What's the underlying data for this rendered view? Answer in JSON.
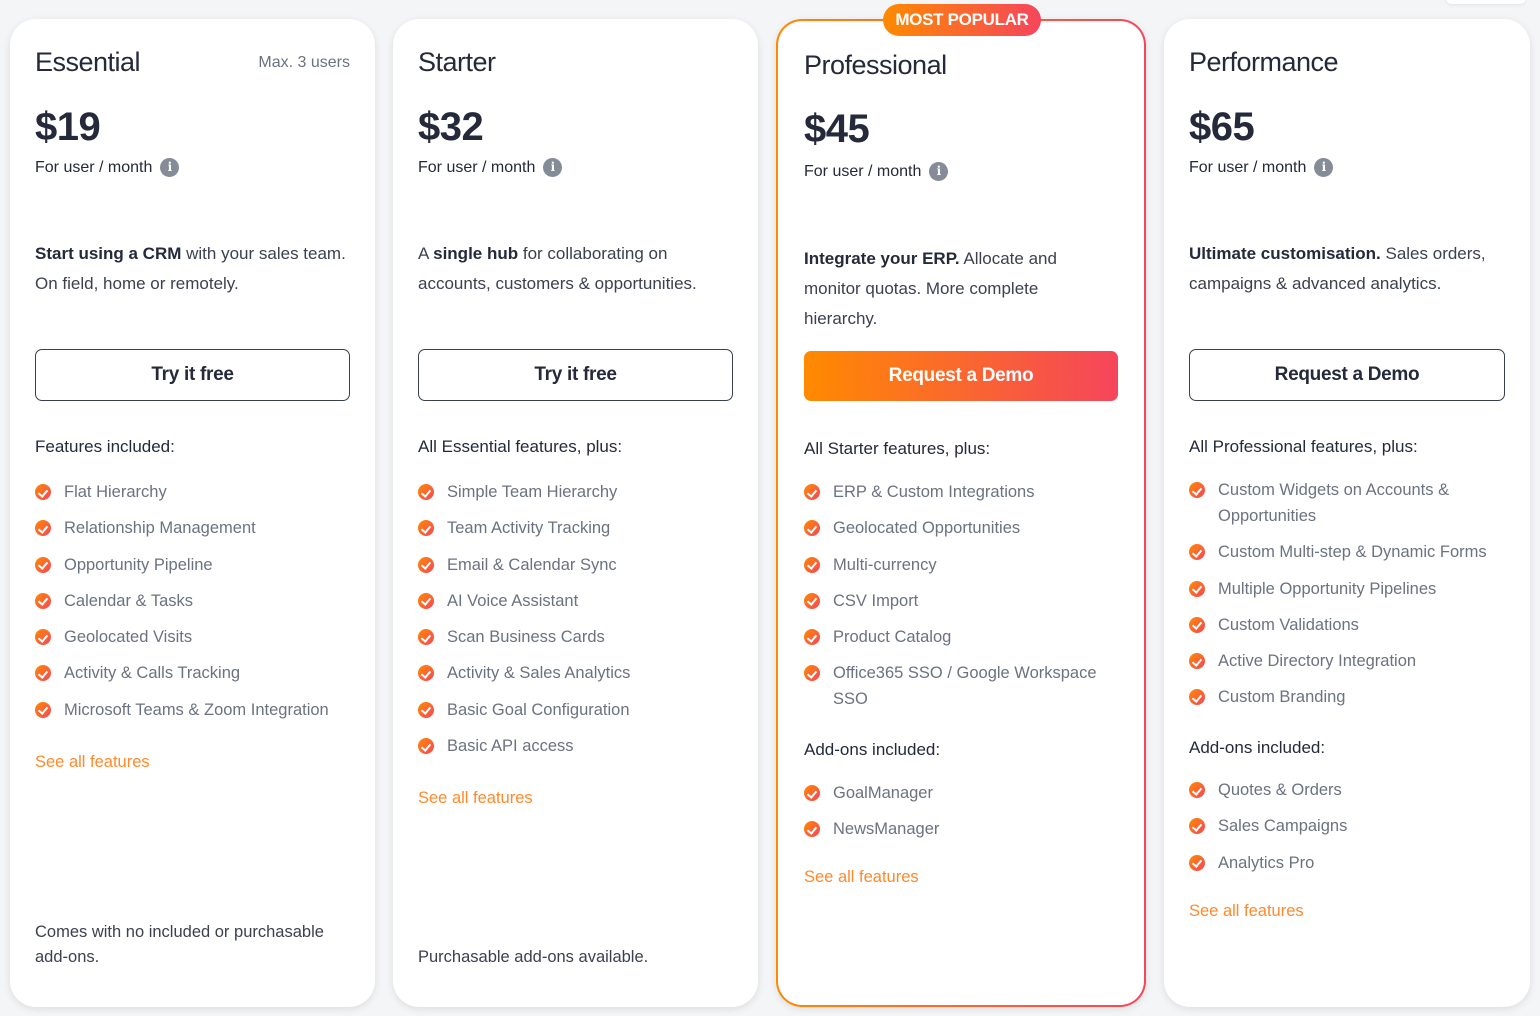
{
  "plans": [
    {
      "name": "Essential",
      "max_users": "Max. 3 users",
      "price": "$19",
      "per": "For user / month",
      "desc_bold": "Start using a CRM",
      "desc_rest": " with your sales team. On field, home or remotely.",
      "desc_prefix": "",
      "cta": "Try it free",
      "features_heading": "Features included:",
      "features": [
        "Flat Hierarchy",
        "Relationship Management",
        "Opportunity Pipeline",
        "Calendar & Tasks",
        "Geolocated Visits",
        "Activity & Calls Tracking",
        "Microsoft Teams & Zoom Integration"
      ],
      "see_all": "See all features",
      "footer": "Comes with no included or purchasable add-ons."
    },
    {
      "name": "Starter",
      "price": "$32",
      "per": "For user / month",
      "desc_prefix": "A ",
      "desc_bold": "single hub",
      "desc_rest": " for collaborating on accounts, customers & opportunities.",
      "cta": "Try it free",
      "features_heading": "All Essential features, plus:",
      "features": [
        "Simple Team Hierarchy",
        "Team Activity Tracking",
        "Email & Calendar Sync",
        "AI Voice Assistant",
        "Scan Business Cards",
        "Activity & Sales Analytics",
        "Basic Goal Configuration",
        "Basic API access"
      ],
      "see_all": "See all features",
      "footer": "Purchasable add-ons available."
    },
    {
      "name": "Professional",
      "badge": "MOST POPULAR",
      "price": "$45",
      "per": "For user / month",
      "desc_prefix": "",
      "desc_bold": "Integrate your ERP.",
      "desc_rest": " Allocate and monitor quotas. More complete hierarchy.",
      "cta": "Request a Demo",
      "features_heading": "All Starter features, plus:",
      "features": [
        "ERP & Custom Integrations",
        "Geolocated Opportunities",
        "Multi-currency",
        "CSV Import",
        "Product Catalog",
        "Office365 SSO / Google Workspace SSO"
      ],
      "addons_heading": "Add-ons included:",
      "addons": [
        "GoalManager",
        "NewsManager"
      ],
      "see_all": "See all features"
    },
    {
      "name": "Performance",
      "price": "$65",
      "per": "For user / month",
      "desc_prefix": "",
      "desc_bold": "Ultimate customisation.",
      "desc_rest": " Sales orders, campaigns & advanced analytics.",
      "cta": "Request a Demo",
      "features_heading": "All Professional features, plus:",
      "features": [
        "Custom Widgets on Accounts & Opportunities",
        "Custom Multi-step & Dynamic Forms",
        "Multiple Opportunity Pipelines",
        "Custom Validations",
        "Active Directory Integration",
        "Custom Branding"
      ],
      "addons_heading": "Add-ons included:",
      "addons": [
        "Quotes & Orders",
        "Sales Campaigns",
        "Analytics Pro"
      ],
      "see_all": "See all features"
    }
  ],
  "colors": {
    "accent_start": "#ff8a00",
    "accent_end": "#f5455c",
    "link": "#ff8a2b",
    "text": "#252a3a",
    "muted": "#6b7280"
  }
}
